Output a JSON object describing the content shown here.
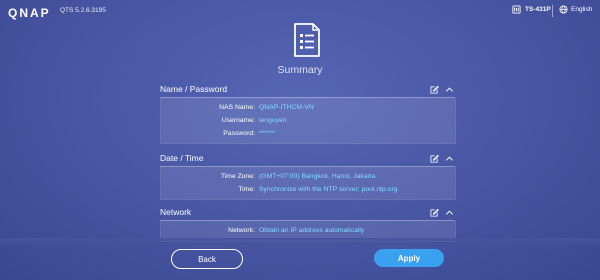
{
  "topbar": {
    "logo": "QNAP",
    "version": "QTS 5.2.6.3195",
    "device": "TS-431P",
    "language": "English"
  },
  "page": {
    "title": "Summary"
  },
  "sections": {
    "name_password": {
      "title": "Name / Password",
      "rows": [
        {
          "label": "NAS Name:",
          "value": "QNAP-ITHCM-VN"
        },
        {
          "label": "Username:",
          "value": "lenguyen"
        },
        {
          "label": "Password:",
          "value": "******"
        }
      ]
    },
    "date_time": {
      "title": "Date / Time",
      "rows": [
        {
          "label": "Time Zone:",
          "value": "(GMT+07:00) Bangkok, Hanoi, Jakarta"
        },
        {
          "label": "Time:",
          "value": "Synchronize with the NTP server: pool.ntp.org"
        }
      ]
    },
    "network": {
      "title": "Network",
      "rows": [
        {
          "label": "Network:",
          "value": "Obtain an IP address automatically"
        }
      ]
    }
  },
  "buttons": {
    "back": "Back",
    "apply": "Apply"
  },
  "colors": {
    "accent": "#39a1ef",
    "value_text": "#7fdcff",
    "background": "#4a58a6"
  },
  "icons": [
    "nas-device-icon",
    "globe-icon",
    "document-icon",
    "edit-icon",
    "chevron-up-icon"
  ]
}
